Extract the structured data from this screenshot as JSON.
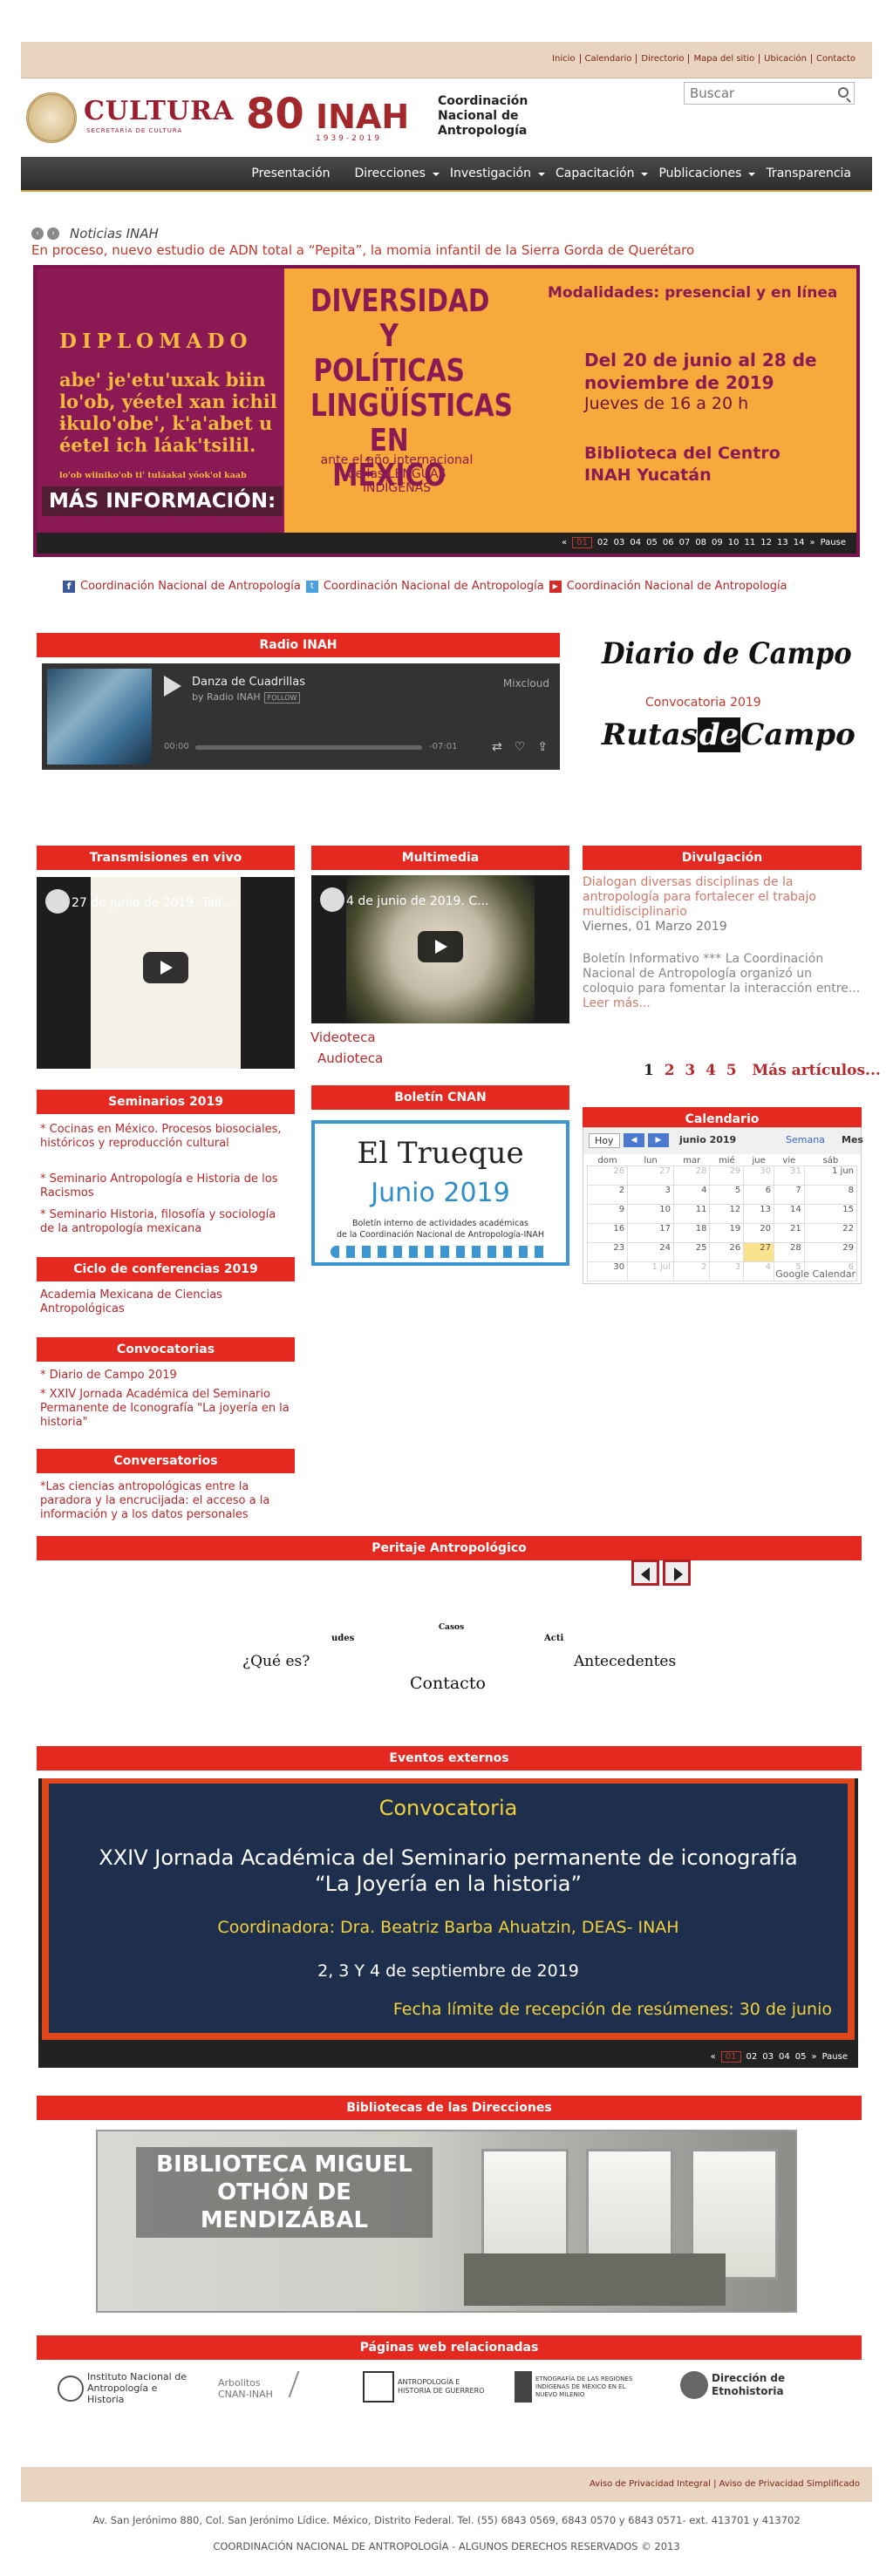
{
  "utility_links": [
    "Inicio",
    "Calendario",
    "Directorio",
    "Mapa del sitio",
    "Ubicación",
    "Contacto"
  ],
  "header": {
    "cultura": "CULTURA",
    "cultura_sub": "SECRETARÍA DE CULTURA",
    "inah_80": "80",
    "inah_word": "INAH",
    "inah_years": "1939-2019",
    "cnan_title": "Coordinación Nacional de Antropología",
    "search_placeholder": "Buscar"
  },
  "nav": [
    "Presentación",
    "Direcciones",
    "Investigación",
    "Capacitación",
    "Publicaciones",
    "Transparencia"
  ],
  "news": {
    "label": "Noticias INAH",
    "headline": "En proceso, nuevo estudio de ADN total a “Pepita”, la momia infantil de la Sierra Gorda de Querétaro"
  },
  "slider1": {
    "diplomado": "DIPLOMADO",
    "maya": "abe' je'etu'uxak biin lo'ob, yéetel xan ichil ɨkulo'obe', k'a'abet u éetel ich láak'tsilil.",
    "maya_small": "lo'ob wiiniko'ob ti' tuláakal yóok'ol kaab",
    "mas_info": "MÁS INFORMACIÓN:",
    "title": "DIVERSIDAD Y POLÍTICAS LINGÜÍSTICAS EN MÉXICO",
    "subtitle": "ante el año internacional de las LENGUAS INDÍGENAS",
    "modalidades": "Modalidades: presencial y en línea",
    "dates": "Del 20 de junio al 28 de noviembre de 2019",
    "hours": "Jueves de 16 a 20 h",
    "biblioteca": "Biblioteca del Centro INAH Yucatán",
    "pager": [
      "«",
      "01",
      "02",
      "03",
      "04",
      "05",
      "06",
      "07",
      "08",
      "09",
      "10",
      "11",
      "12",
      "13",
      "14",
      "»",
      "Pause"
    ]
  },
  "social": {
    "fb": "Coordinación Nacional de Antropología",
    "tw": "Coordinación Nacional de Antropología",
    "yt": "Coordinación Nacional de Antropología"
  },
  "radio": {
    "header": "Radio INAH",
    "track": "Danza de Cuadrillas",
    "by": "by Radio INAH",
    "follow": "FOLLOW",
    "mixcloud": "Mixcloud",
    "time_start": "00:00",
    "time_end": "-07:01"
  },
  "diario": {
    "title": "Diario de Campo",
    "convocatoria": "Convocatoria 2019",
    "rutas_1": "Rutas",
    "rutas_2": "de",
    "rutas_3": "Campo"
  },
  "transmisiones": {
    "header": "Transmisiones en vivo",
    "video_title": "27 de junio de 2019. Tall..."
  },
  "multimedia": {
    "header": "Multimedia",
    "video_title": "4 de junio de 2019. C...",
    "videoteca": "Videoteca",
    "audioteca": "Audioteca"
  },
  "divulgacion": {
    "header": "Divulgación",
    "item1_title": "Dialogan diversas disciplinas de la antropología para fortalecer el trabajo multidisciplinario",
    "item1_date": "Viernes, 01 Marzo 2019",
    "item2_text": "Boletín Informativo   *** La Coordinación Nacional de Antropología organizó un coloquio para fomentar la interacción entre...",
    "leer_mas": "Leer más...",
    "pages": [
      "1",
      "2",
      "3",
      "4",
      "5"
    ],
    "mas_articulos": "Más artículos..."
  },
  "seminarios": {
    "header": "Seminarios 2019",
    "items": [
      "* Cocinas en México. Procesos biosociales, históricos y reproducción cultural",
      "* Seminario Antropología e Historia de los Racismos",
      "* Seminario Historia, filosofía y sociología de la antropología mexicana"
    ]
  },
  "ciclo": {
    "header": "Ciclo de conferencias 2019",
    "item": "Academia Mexicana de Ciencias Antropológicas"
  },
  "convocatorias": {
    "header": "Convocatorias",
    "items": [
      "* Diario de Campo 2019",
      "* XXIV Jornada Académica del Seminario Permanente de Iconografía \"La joyería en la historia\""
    ]
  },
  "conversatorios": {
    "header": "Conversatorios",
    "item": "*Las ciencias antropológicas entre la paradora y la encrucijada: el acceso a la información y a los datos personales"
  },
  "boletin": {
    "header": "Boletín CNAN",
    "t1": "El Trueque",
    "t2": "Junio 2019",
    "t3a": "Boletín interno de actividades académicas",
    "t3b": "de la Coordinación Nacional de Antropología-INAH"
  },
  "calendario": {
    "header": "Calendario",
    "hoy": "Hoy",
    "month": "junio 2019",
    "semana": "Semana",
    "mes": "Mes",
    "days": [
      "dom",
      "lun",
      "mar",
      "mié",
      "jue",
      "vie",
      "sáb"
    ],
    "weeks": [
      [
        "26",
        "27",
        "28",
        "29",
        "30",
        "31",
        "1 jun"
      ],
      [
        "2",
        "3",
        "4",
        "5",
        "6",
        "7",
        "8"
      ],
      [
        "9",
        "10",
        "11",
        "12",
        "13",
        "14",
        "15"
      ],
      [
        "16",
        "17",
        "18",
        "19",
        "20",
        "21",
        "22"
      ],
      [
        "23",
        "24",
        "25",
        "26",
        "27",
        "28",
        "29"
      ],
      [
        "30",
        "1 jul",
        "2",
        "3",
        "4",
        "5",
        "6"
      ]
    ],
    "google": "Google Calendar"
  },
  "peritaje": {
    "header": "Peritaje Antropológico",
    "casos": "Casos",
    "udes": "udes",
    "acti": "Acti",
    "que_es": "¿Qué es?",
    "antecedentes": "Antecedentes",
    "contacto": "Contacto"
  },
  "eventos": {
    "header": "Eventos externos",
    "c1": "Convocatoria",
    "c2a": "XXIV Jornada Académica del Seminario permanente de iconografía",
    "c2b": "“La Joyería en la historia”",
    "c3": "Coordinadora: Dra. Beatriz Barba Ahuatzin, DEAS- INAH",
    "c4": "2, 3 Y 4 de septiembre de 2019",
    "c5": "Fecha límite de recepción de resúmenes: 30 de junio",
    "pager": [
      "«",
      "01",
      "02",
      "03",
      "04",
      "05",
      "»",
      "Pause"
    ]
  },
  "bibliotecas": {
    "header": "Bibliotecas de las Direcciones",
    "caption": "BIBLIOTECA MIGUEL OTHÓN DE MENDIZÁBAL"
  },
  "relacionadas": {
    "header": "Páginas web relacionadas",
    "items": [
      "Instituto Nacional de Antropología e Historia",
      "Arbolitos CNAN-INAH",
      "ANTROPOLOGÍA E HISTORIA DE GUERRERO",
      "ETNOGRAFÍA DE LAS REGIONES INDÍGENAS DE MÉXICO EN EL NUEVO MILENIO",
      "Dirección de Etnohistoria"
    ]
  },
  "footer": {
    "privacy1": "Aviso de Privacidad Integral",
    "privacy2": "Aviso de Privacidad Simplificado",
    "address": "Av. San Jerónimo 880, Col. San Jerónimo Lídice. México, Distrito Federal.  Tel. (55) 6843 0569, 6843 0570 y 6843 0571- ext. 413701 y 413702",
    "copyright": "COORDINACIÓN NACIONAL DE ANTROPOLOGÍA - ALGUNOS DERECHOS RESERVADOS © 2013"
  },
  "colors": {
    "red_header": "#e42a20",
    "link_red": "#b5282b",
    "beige_bar": "#e8d4c0",
    "nav_dark": "#3a3a3a",
    "slide_purple": "#8a1954",
    "slide_orange": "#f7a93b",
    "event_navy": "#1d2f4d"
  }
}
